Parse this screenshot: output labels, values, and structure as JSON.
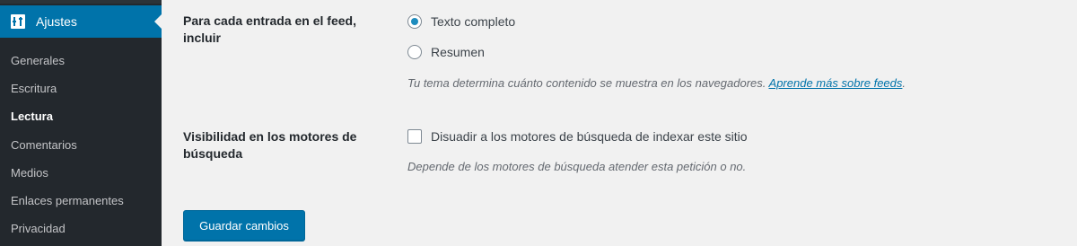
{
  "sidebar": {
    "active_menu": {
      "label": "Ajustes",
      "icon": "settings-icon"
    },
    "items": [
      {
        "label": "Generales",
        "current": false
      },
      {
        "label": "Escritura",
        "current": false
      },
      {
        "label": "Lectura",
        "current": true
      },
      {
        "label": "Comentarios",
        "current": false
      },
      {
        "label": "Medios",
        "current": false
      },
      {
        "label": "Enlaces permanentes",
        "current": false
      },
      {
        "label": "Privacidad",
        "current": false
      }
    ]
  },
  "feed": {
    "label": "Para cada entrada en el feed, incluir",
    "options": [
      {
        "label": "Texto completo",
        "selected": true
      },
      {
        "label": "Resumen",
        "selected": false
      }
    ],
    "description": "Tu tema determina cuánto contenido se muestra en los navegadores.",
    "link_text": "Aprende más sobre feeds",
    "link_suffix": "."
  },
  "visibility": {
    "label": "Visibilidad en los motores de búsqueda",
    "checkbox_label": "Disuadir a los motores de búsqueda de indexar este sitio",
    "checked": false,
    "description": "Depende de los motores de búsqueda atender esta petición o no."
  },
  "save_button": {
    "label": "Guardar cambios"
  },
  "colors": {
    "accent": "#0073aa",
    "sidebar": "#23282d",
    "background": "#f1f1f1"
  }
}
